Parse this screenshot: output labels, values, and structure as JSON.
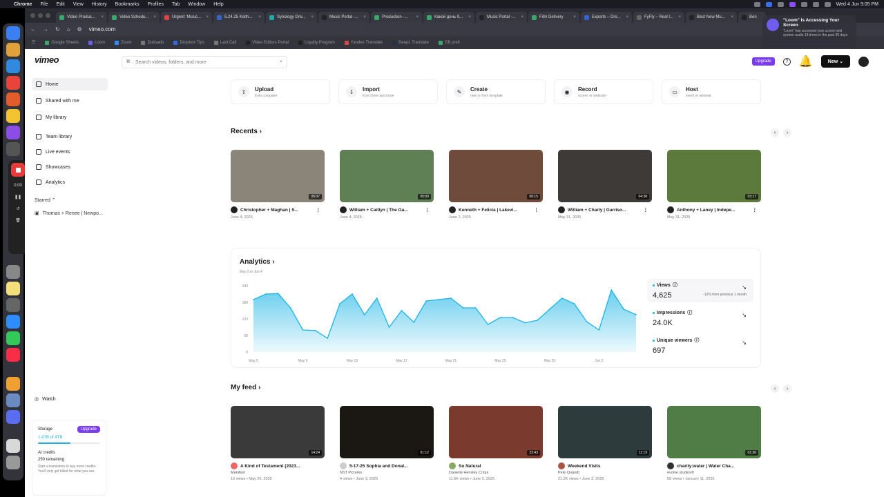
{
  "menubar": {
    "app": "Chrome",
    "menus": [
      "File",
      "Edit",
      "View",
      "History",
      "Bookmarks",
      "Profiles",
      "Tab",
      "Window",
      "Help"
    ],
    "datetime": "Wed 4 Jun 9:05 PM"
  },
  "tabs": [
    "Video Produc...",
    "Video Schedu...",
    "Urgent: Music...",
    "5.24.25 Keith...",
    "Synology Driv...",
    "Music Portal -...",
    "Production -...",
    "Какой день б...",
    "Music Portal -...",
    "Film Delivery",
    "Exports – Dro...",
    "FyFly – Real I...",
    "Best New Mu...",
    "Ben"
  ],
  "address": {
    "url": "vimeo.com"
  },
  "bookmarks": [
    "Google Sheets",
    "Loom",
    "Zoom",
    "Dubsado",
    "Dropbox Tips",
    "Last Call",
    "Video Editors Portal",
    "Loyalty Program",
    "Yandex Translate",
    "DeepL Translate",
    "GB prell"
  ],
  "loom_ctrl": {
    "time": "0:00"
  },
  "notification": {
    "title": "\"Loom\" Is Accessing Your Screen",
    "body": "\"Loom\" has accessed your screen and system audio 18 times in the past 30 days"
  },
  "header": {
    "logo": "vimeo",
    "search_placeholder": "Search videos, folders, and more",
    "upgrade": "Upgrade",
    "new": "New"
  },
  "sidebar": {
    "items": [
      "Home",
      "Shared with me",
      "My library",
      "Team library",
      "Live events",
      "Showcases",
      "Analytics"
    ],
    "starred": "Starred",
    "starred_item": "Thomas + Renee | Newpo...",
    "watch": "Watch",
    "storage_label": "Storage",
    "storage_upgrade": "Upgrade",
    "storage_value": "1.4TB of 4TB",
    "ai_label": "AI credits",
    "ai_remaining": "250 remaining",
    "ai_note": "Start a translation to buy more credits. You'll only get billed for what you use."
  },
  "actions": [
    {
      "label": "Upload",
      "sub": "from computer",
      "icon": "⇧"
    },
    {
      "label": "Import",
      "sub": "from Drive and more",
      "icon": "⇩"
    },
    {
      "label": "Create",
      "sub": "new or from template",
      "icon": "✎"
    },
    {
      "label": "Record",
      "sub": "screen or webcam",
      "icon": "◉"
    },
    {
      "label": "Host",
      "sub": "event or webinar",
      "icon": "▭"
    }
  ],
  "recents": {
    "title": "Recents",
    "items": [
      {
        "title": "Christopher + Maghan | S...",
        "date": "June 4, 2025",
        "duration": "05:07",
        "thumb": "#8b8579"
      },
      {
        "title": "William + Caitlyn | The Ga...",
        "date": "June 4, 2025",
        "duration": "05:00",
        "thumb": "#5f7f55"
      },
      {
        "title": "Kenneth + Felicia | Lakevi...",
        "date": "June 2, 2025",
        "duration": "06:15",
        "thumb": "#6e4b3a"
      },
      {
        "title": "William + Charly | Garriso...",
        "date": "May 31, 2025",
        "duration": "04:38",
        "thumb": "#3d3a38"
      },
      {
        "title": "Anthony + Laney | Indepe...",
        "date": "May 31, 2025",
        "duration": "03:17",
        "thumb": "#5c7a3c"
      }
    ]
  },
  "analytics": {
    "title": "Analytics",
    "range": "May 5 to Jun 4",
    "metrics": [
      {
        "label": "Views",
        "value": "4,625",
        "change": "-12% from previous 1 month"
      },
      {
        "label": "Impressions",
        "value": "24.0K",
        "change": ""
      },
      {
        "label": "Unique viewers",
        "value": "697",
        "change": ""
      }
    ]
  },
  "chart_data": {
    "type": "area",
    "y_ticks": [
      "240",
      "180",
      "120",
      "60",
      "0"
    ],
    "x_ticks": [
      "May 5",
      "May 9",
      "May 13",
      "May 17",
      "May 21",
      "May 25",
      "May 29",
      "Jun 2"
    ],
    "ylim": [
      0,
      240
    ],
    "values": [
      190,
      210,
      212,
      160,
      80,
      78,
      50,
      175,
      210,
      135,
      195,
      90,
      150,
      108,
      185,
      190,
      195,
      160,
      160,
      100,
      125,
      125,
      106,
      115,
      155,
      195,
      175,
      110,
      80,
      225,
      155,
      135
    ],
    "color": "#19b4e6"
  },
  "feed": {
    "title": "My feed",
    "items": [
      {
        "title": "A Kind of Testament (2023...",
        "author": "Manifest",
        "meta": "16 views • May 26, 2025",
        "duration": "14:24",
        "thumb": "#3a3a3a"
      },
      {
        "title": "5-17-25 Sophia and Donal...",
        "author": "NST Pictures",
        "meta": "4 views • June 3, 2025",
        "duration": "01:12",
        "thumb": "#1b1712"
      },
      {
        "title": "So Natural",
        "author": "Danielle Hensley Criqui",
        "meta": "11.6K views • June 2, 2025",
        "duration": "22:43",
        "thumb": "#7a3b2e"
      },
      {
        "title": "Weekend Visits",
        "author": "Pete Quandt",
        "meta": "21.2K views • June 2, 2025",
        "duration": "11:19",
        "thumb": "#2d3b3c"
      },
      {
        "title": "charity:water | Water Cha...",
        "author": "evolve studios®",
        "meta": "58 views • January 11, 2025",
        "duration": "01:36",
        "thumb": "#4f7d45"
      }
    ]
  }
}
